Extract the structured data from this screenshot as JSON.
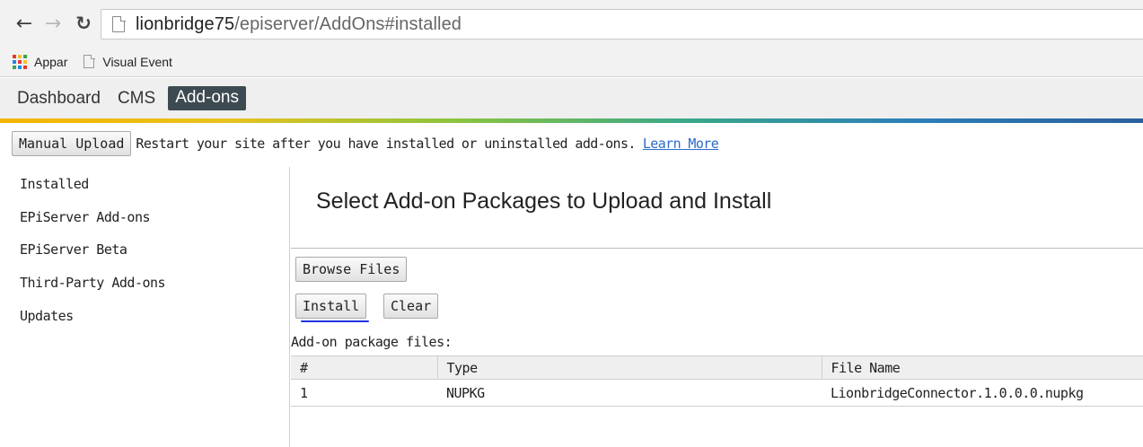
{
  "browser": {
    "url_host": "lionbridge75",
    "url_path": "/episerver/AddOns#installed",
    "bookmarks": [
      {
        "label": "Appar",
        "icon": "apps-grid-icon"
      },
      {
        "label": "Visual Event",
        "icon": "page-icon"
      }
    ]
  },
  "global_nav": {
    "dashboard": "Dashboard",
    "cms": "CMS",
    "addons": "Add-ons"
  },
  "toolbar": {
    "manual_upload": "Manual Upload",
    "notice": "Restart your site after you have installed or uninstalled add-ons.",
    "learn_more": "Learn More"
  },
  "sidebar": {
    "items": [
      {
        "label": "Installed"
      },
      {
        "label": "EPiServer Add-ons"
      },
      {
        "label": "EPiServer Beta"
      },
      {
        "label": "Third-Party Add-ons"
      },
      {
        "label": "Updates"
      }
    ]
  },
  "main": {
    "heading": "Select Add-on Packages to Upload and Install",
    "browse_files": "Browse Files",
    "install": "Install",
    "clear": "Clear",
    "files_label": "Add-on package files:",
    "table": {
      "columns": [
        "#",
        "Type",
        "File Name"
      ],
      "rows": [
        [
          "1",
          "NUPKG",
          "LionbridgeConnector.1.0.0.0.nupkg"
        ]
      ]
    }
  },
  "colors": {
    "active_tab_bg": "#3d4a52",
    "link": "#2a6ac8",
    "install_underline": "#2233dd"
  }
}
